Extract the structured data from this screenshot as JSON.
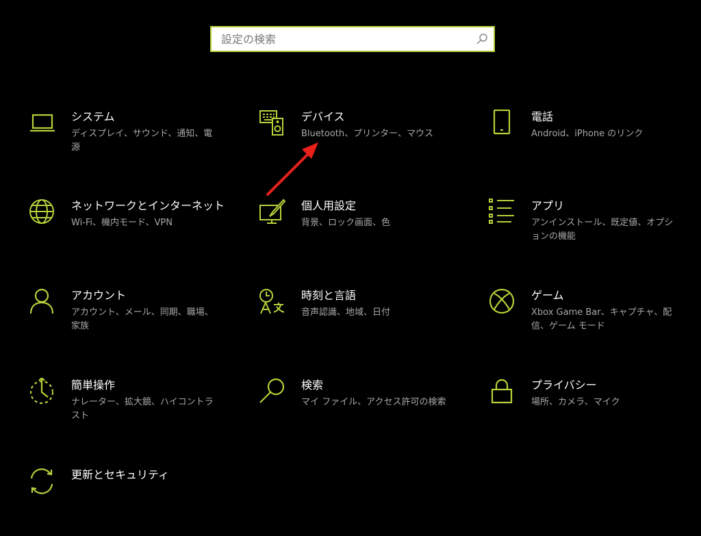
{
  "search": {
    "placeholder": "設定の検索",
    "value": ""
  },
  "accent": "#b6d33a",
  "annotation_color": "#e8201a",
  "tiles": [
    {
      "icon": "laptop-icon",
      "title": "システム",
      "subtitle": "ディスプレイ、サウンド、通知、電源"
    },
    {
      "icon": "devices-icon",
      "title": "デバイス",
      "subtitle": "Bluetooth、プリンター、マウス"
    },
    {
      "icon": "phone-icon",
      "title": "電話",
      "subtitle": "Android、iPhone のリンク"
    },
    {
      "icon": "globe-icon",
      "title": "ネットワークとインターネット",
      "subtitle": "Wi-Fi、機内モード、VPN"
    },
    {
      "icon": "personalization-icon",
      "title": "個人用設定",
      "subtitle": "背景、ロック画面、色"
    },
    {
      "icon": "apps-list-icon",
      "title": "アプリ",
      "subtitle": "アンインストール、既定値、オプションの機能"
    },
    {
      "icon": "person-icon",
      "title": "アカウント",
      "subtitle": "アカウント、メール、同期、職場、家族"
    },
    {
      "icon": "time-language-icon",
      "title": "時刻と言語",
      "subtitle": "音声認識、地域、日付"
    },
    {
      "icon": "xbox-icon",
      "title": "ゲーム",
      "subtitle": "Xbox Game Bar、キャプチャ、配信、ゲーム モード"
    },
    {
      "icon": "ease-of-access-icon",
      "title": "簡単操作",
      "subtitle": "ナレーター、拡大鏡、ハイコントラスト"
    },
    {
      "icon": "search-icon",
      "title": "検索",
      "subtitle": "マイ ファイル、アクセス許可の検索"
    },
    {
      "icon": "lock-icon",
      "title": "プライバシー",
      "subtitle": "場所、カメラ、マイク"
    },
    {
      "icon": "update-icon",
      "title": "更新とセキュリティ",
      "subtitle": ""
    }
  ]
}
